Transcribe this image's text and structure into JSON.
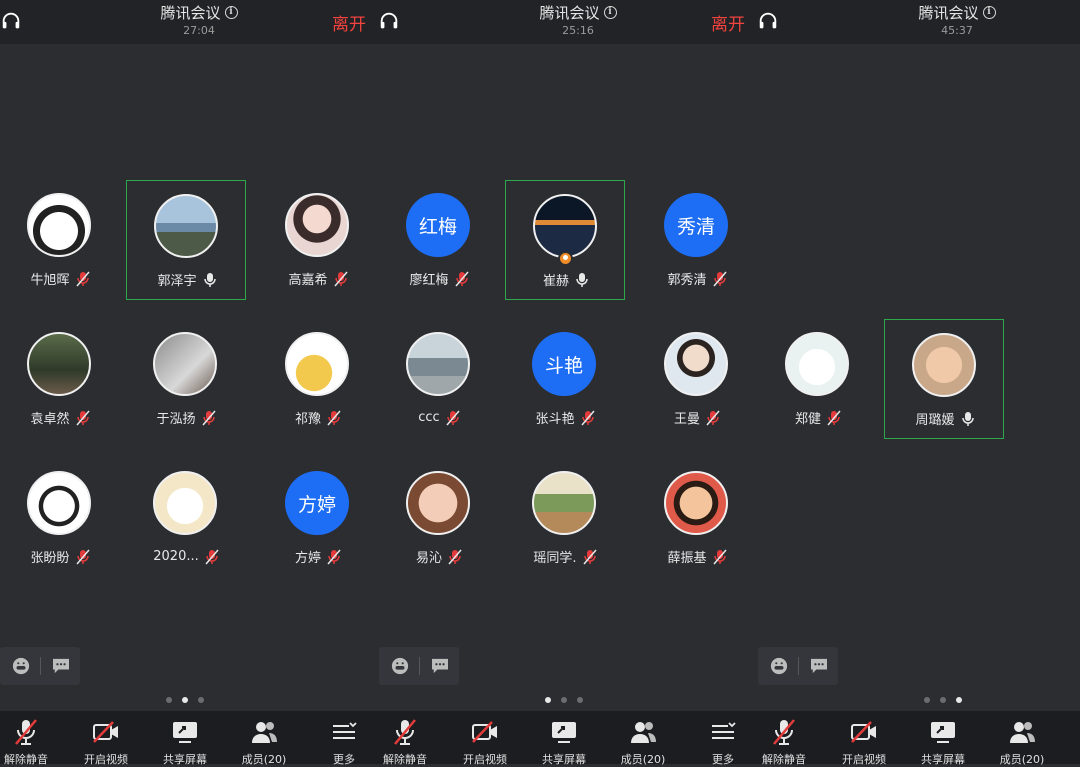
{
  "panels": [
    {
      "title": "腾讯会议",
      "timer": "27:04",
      "leave": "离开",
      "participants": [
        {
          "name": "牛旭晖",
          "avatar": "cat-cartoon",
          "mic": "muted",
          "active": false
        },
        {
          "name": "郭泽宇",
          "avatar": "seaside-photo",
          "mic": "on",
          "active": true
        },
        {
          "name": "高嘉希",
          "avatar": "girl-with-glasses",
          "mic": "muted",
          "active": false
        },
        {
          "name": "袁卓然",
          "avatar": "forest-photo",
          "mic": "muted",
          "active": false
        },
        {
          "name": "于泓扬",
          "avatar": "child-photo",
          "mic": "muted",
          "active": false
        },
        {
          "name": "祁豫",
          "avatar": "rabbit-moon-cartoon",
          "mic": "muted",
          "active": false
        },
        {
          "name": "张盼盼",
          "avatar": "panda-cartoon",
          "mic": "muted",
          "active": false
        },
        {
          "name": "2020...",
          "avatar": "bear-cartoon",
          "mic": "muted",
          "active": false
        },
        {
          "name": "方婷",
          "initials": "方婷",
          "mic": "muted",
          "active": false
        }
      ],
      "page_index": 1
    },
    {
      "title": "腾讯会议",
      "timer": "25:16",
      "leave": "离开",
      "participants": [
        {
          "name": "廖红梅",
          "initials": "红梅",
          "mic": "muted",
          "active": false
        },
        {
          "name": "崔赫",
          "avatar": "night-sea-photo",
          "mic": "on",
          "active": true,
          "host": true
        },
        {
          "name": "郭秀清",
          "initials": "秀清",
          "mic": "muted",
          "active": false
        },
        {
          "name": "ccc",
          "avatar": "street-photo",
          "mic": "muted",
          "active": false
        },
        {
          "name": "张斗艳",
          "initials": "斗艳",
          "mic": "muted",
          "active": false
        },
        {
          "name": "王曼",
          "avatar": "boy-photo",
          "mic": "muted",
          "active": false
        },
        {
          "name": "易沁",
          "avatar": "baby-photo",
          "mic": "muted",
          "active": false
        },
        {
          "name": "瑶同学.",
          "avatar": "girl-bench-photo",
          "mic": "muted",
          "active": false
        },
        {
          "name": "薛振基",
          "avatar": "anime-boy",
          "mic": "muted",
          "active": false
        }
      ],
      "page_index": 0
    },
    {
      "title": "腾讯会议",
      "timer": "45:37",
      "leave": "",
      "participants": [
        {
          "name": "郑健",
          "avatar": "cat-white-cartoon",
          "mic": "muted",
          "active": false
        },
        {
          "name": "周璐媛",
          "avatar": "baby-smile-photo",
          "mic": "on",
          "active": true
        }
      ],
      "page_index": 2
    }
  ],
  "toolbar": {
    "unmute": "解除静音",
    "video": "开启视频",
    "share": "共享屏幕",
    "members": "成员(20)",
    "more": "更多"
  },
  "colors": {
    "accent_green": "#2fa84a",
    "leave_red": "#f2433e",
    "initials_blue": "#1e6ef5",
    "muted_red": "#e33b3b"
  }
}
